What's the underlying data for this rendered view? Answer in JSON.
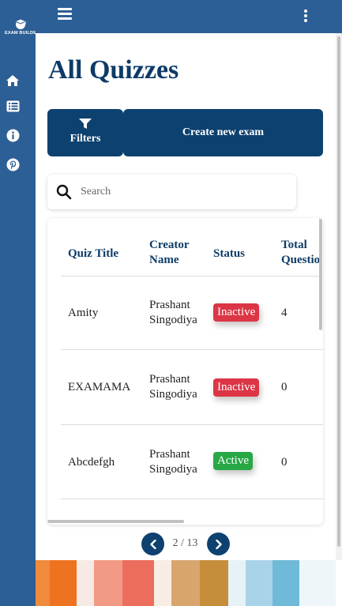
{
  "app": {
    "brand_text": "EXAM BUILDER"
  },
  "sidebar": {
    "items": [
      {
        "name": "home",
        "icon": "home-icon"
      },
      {
        "name": "quizzes",
        "icon": "list-icon"
      },
      {
        "name": "about",
        "icon": "info-icon"
      },
      {
        "name": "pinterest",
        "icon": "pinterest-icon"
      }
    ]
  },
  "page": {
    "title": "All Quizzes"
  },
  "toolbar": {
    "filters_label": "Filters",
    "create_label": "Create new exam"
  },
  "search": {
    "placeholder": "Search",
    "value": ""
  },
  "table": {
    "columns": {
      "title": "Quiz Title",
      "creator": "Creator Name",
      "status": "Status",
      "total": "Total Questions"
    },
    "rows": [
      {
        "title": "Amity",
        "creator_first": "Prashant",
        "creator_last": "Singodiya",
        "status": "Inactive",
        "total": "4"
      },
      {
        "title": "EXAMAMA",
        "creator_first": "Prashant",
        "creator_last": "Singodiya",
        "status": "Inactive",
        "total": "0"
      },
      {
        "title": "Abcdefgh",
        "creator_first": "Prashant",
        "creator_last": "Singodiya",
        "status": "Active",
        "total": "0"
      }
    ]
  },
  "pagination": {
    "text": "2 / 13"
  },
  "colors": {
    "primary": "#0d4170",
    "sidebar": "#2c5f96",
    "inactive": "#dc3545",
    "active": "#28a745",
    "title": "#0d3b66"
  },
  "footer_palette": [
    "#f08a3c",
    "#ee7320",
    "#f7e9e4",
    "#f29a85",
    "#ec6d5c",
    "#f8ede4",
    "#d8a56d",
    "#c68e3a",
    "#e7f2f6",
    "#a9d3e8",
    "#6fbad8",
    "#eef6f9"
  ]
}
